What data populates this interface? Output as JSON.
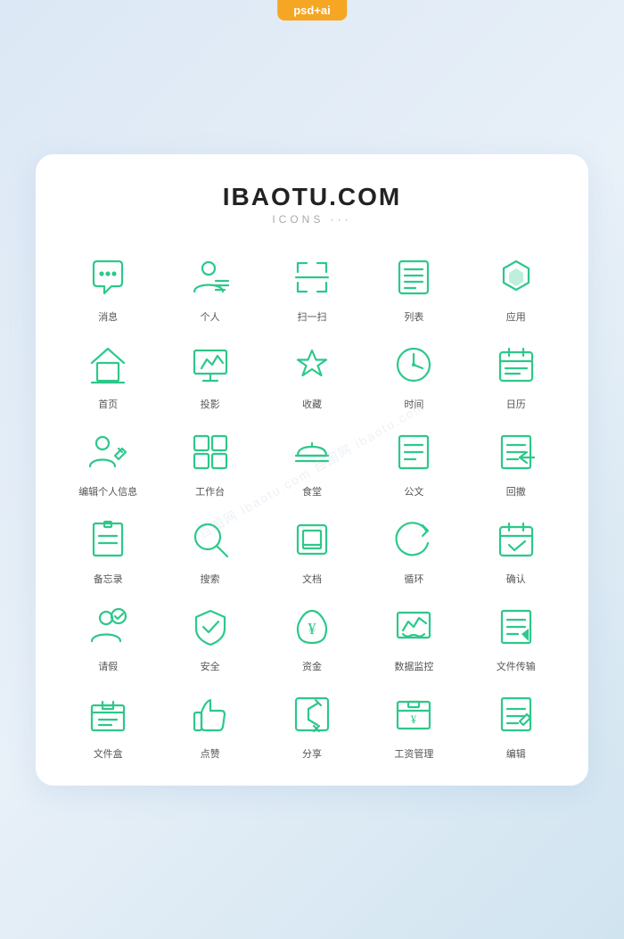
{
  "badge": "psd+ai",
  "header": {
    "title": "IBAOTU.COM",
    "subtitle": "ICONS ···"
  },
  "icons": [
    {
      "id": "message",
      "label": "消息"
    },
    {
      "id": "person",
      "label": "个人"
    },
    {
      "id": "scan",
      "label": "扫一扫"
    },
    {
      "id": "list",
      "label": "列表"
    },
    {
      "id": "app",
      "label": "应用"
    },
    {
      "id": "home",
      "label": "首页"
    },
    {
      "id": "projection",
      "label": "投影"
    },
    {
      "id": "favorite",
      "label": "收藏"
    },
    {
      "id": "time",
      "label": "时间"
    },
    {
      "id": "calendar",
      "label": "日历"
    },
    {
      "id": "edit-profile",
      "label": "编辑个人信息"
    },
    {
      "id": "workbench",
      "label": "工作台"
    },
    {
      "id": "canteen",
      "label": "食堂"
    },
    {
      "id": "document",
      "label": "公文"
    },
    {
      "id": "undo",
      "label": "回撤"
    },
    {
      "id": "memo",
      "label": "备忘录"
    },
    {
      "id": "search",
      "label": "搜索"
    },
    {
      "id": "file",
      "label": "文档"
    },
    {
      "id": "loop",
      "label": "循环"
    },
    {
      "id": "confirm",
      "label": "确认"
    },
    {
      "id": "leave",
      "label": "请假"
    },
    {
      "id": "security",
      "label": "安全"
    },
    {
      "id": "fund",
      "label": "资金"
    },
    {
      "id": "data-monitor",
      "label": "数据监控"
    },
    {
      "id": "file-transfer",
      "label": "文件传输"
    },
    {
      "id": "file-box",
      "label": "文件盒"
    },
    {
      "id": "like",
      "label": "点赞"
    },
    {
      "id": "share",
      "label": "分享"
    },
    {
      "id": "salary",
      "label": "工资管理"
    },
    {
      "id": "edit",
      "label": "编辑"
    }
  ]
}
